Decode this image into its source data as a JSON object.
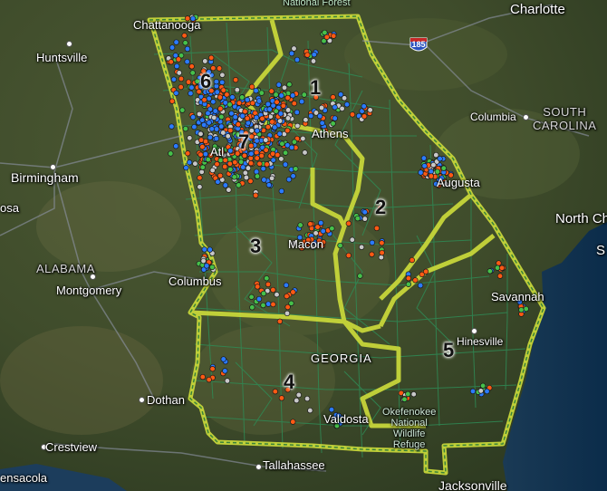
{
  "map": {
    "colors": {
      "district_boundary": "#c7d63a",
      "county_lines": "#2f8a55",
      "point_orange": "#ff5a14",
      "point_blue": "#2b7bff",
      "point_green": "#46c04a",
      "point_gray": "#c8c8c8"
    },
    "districts": [
      {
        "number": "1"
      },
      {
        "number": "2"
      },
      {
        "number": "3"
      },
      {
        "number": "4"
      },
      {
        "number": "5"
      },
      {
        "number": "6"
      },
      {
        "number": "7"
      }
    ],
    "cities": {
      "chattanooga": "Chattanooga",
      "charlotte": "Charlotte",
      "huntsville": "Huntsville",
      "birmingham": "Birmingham",
      "athens": "Athens",
      "augusta": "Augusta",
      "columbia": "Columbia",
      "atlanta": "Atl",
      "macon": "Macon",
      "columbus": "Columbus",
      "montgomery": "Montgomery",
      "savannah": "Savannah",
      "hinesville": "Hinesville",
      "dothan": "Dothan",
      "valdosta": "Valdosta",
      "crestview": "Crestview",
      "tallahassee": "Tallahassee",
      "pensacola": "ensacola",
      "jacksonville": "Jacksonville",
      "north_charleston": "North Ch",
      "rosa": "osa"
    },
    "states": {
      "alabama": "ALABAMA",
      "south_carolina_1": "SOUTH",
      "south_carolina_2": "CAROLINA",
      "georgia": "GEORGIA"
    },
    "features": {
      "national_forest": "National Forest",
      "okefenokee_1": "Okefenokee",
      "okefenokee_2": "National",
      "okefenokee_3": "Wildlife",
      "okefenokee_4": "Refuge",
      "interstate": "185",
      "sc_partial": "S"
    }
  }
}
